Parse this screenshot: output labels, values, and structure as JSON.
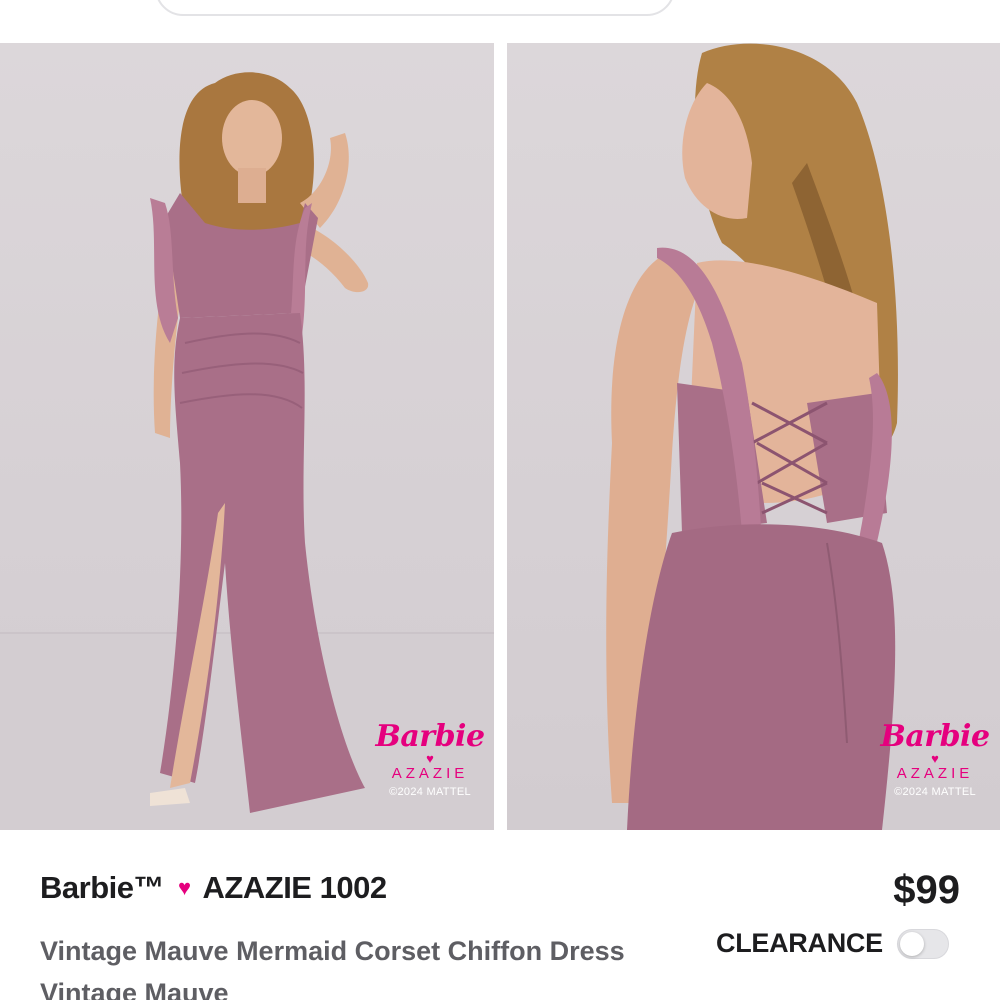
{
  "colors": {
    "brand_pink": "#e5007e",
    "dress_mauve": "#a96f88",
    "text_dark": "#1d1d1f",
    "text_muted": "#5e5e63"
  },
  "images": [
    {
      "name": "product-photo-front",
      "watermark": {
        "barbie": "Barbie",
        "heart": "♥",
        "azazie": "AZAZIE",
        "copyright": "©2024 MATTEL"
      }
    },
    {
      "name": "product-photo-back",
      "watermark": {
        "barbie": "Barbie",
        "heart": "♥",
        "azazie": "AZAZIE",
        "copyright": "©2024 MATTEL"
      }
    }
  ],
  "product": {
    "brand_left": "Barbie™",
    "brand_heart": "♥",
    "brand_right": "AZAZIE 1002",
    "price": "$99",
    "clearance_label": "CLEARANCE",
    "clearance_on": false,
    "description": "Vintage Mauve Mermaid Corset Chiffon Dress Vintage Mauve"
  }
}
